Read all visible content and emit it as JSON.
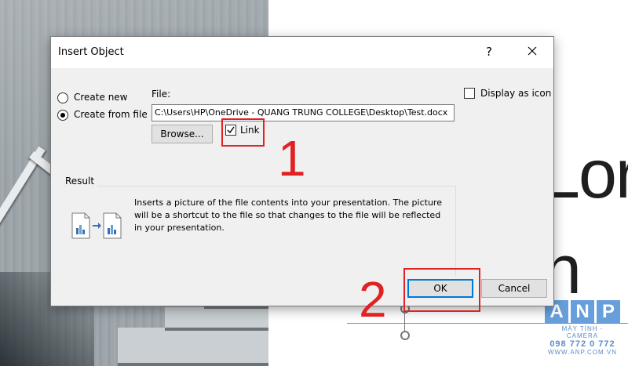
{
  "dialog": {
    "title": "Insert Object",
    "help": "?",
    "options": [
      {
        "label": "Create new",
        "selected": false
      },
      {
        "label": "Create from file",
        "selected": true
      }
    ],
    "file_label": "File:",
    "file_value": "C:\\Users\\HP\\OneDrive - QUANG TRUNG COLLEGE\\Desktop\\Test.docx",
    "browse_label": "Browse...",
    "link_label": "Link",
    "link_checked": true,
    "display_icon_label": "Display as icon",
    "display_icon_checked": false,
    "result_label": "Result",
    "result_text": "Inserts a picture of the file contents into your presentation. The picture will be a shortcut to the file so that changes to the file will be reflected in your presentation.",
    "ok_label": "OK",
    "cancel_label": "Cancel"
  },
  "annotations": {
    "step1": "1",
    "step2": "2",
    "color": "#e02222"
  },
  "slide": {
    "text1": "Lor",
    "text2": "n"
  },
  "watermark": {
    "letters": [
      "A",
      "N",
      "P"
    ],
    "tagline": "MÁY TÍNH - CAMERA",
    "phone": "098 772 0 772",
    "url": "WWW.ANP.COM.VN"
  },
  "colors": {
    "accent": "#0078d7",
    "dialog_bg": "#f0f0f0",
    "annotation": "#e02222"
  }
}
